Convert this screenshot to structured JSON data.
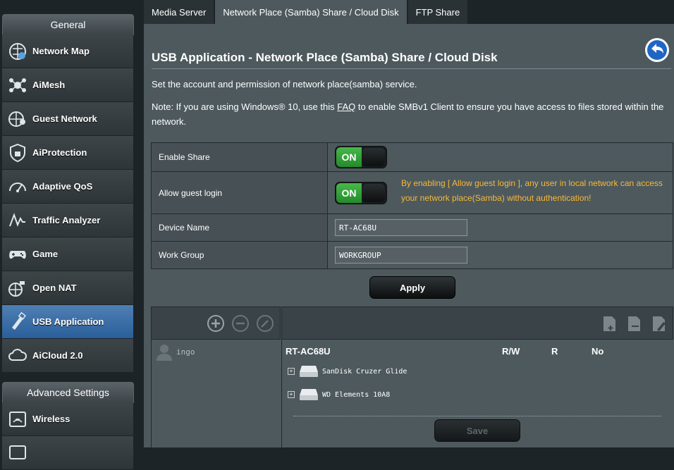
{
  "sidebar": {
    "general_header": "General",
    "general_items": [
      {
        "label": "Network Map",
        "icon": "network-map-icon"
      },
      {
        "label": "AiMesh",
        "icon": "aimesh-icon"
      },
      {
        "label": "Guest Network",
        "icon": "guest-network-icon"
      },
      {
        "label": "AiProtection",
        "icon": "aiprotection-icon"
      },
      {
        "label": "Adaptive QoS",
        "icon": "adaptive-qos-icon"
      },
      {
        "label": "Traffic Analyzer",
        "icon": "traffic-analyzer-icon"
      },
      {
        "label": "Game",
        "icon": "game-icon"
      },
      {
        "label": "Open NAT",
        "icon": "open-nat-icon"
      },
      {
        "label": "USB Application",
        "icon": "usb-application-icon",
        "active": true
      },
      {
        "label": "AiCloud 2.0",
        "icon": "aicloud-icon"
      }
    ],
    "advanced_header": "Advanced Settings",
    "advanced_items": [
      {
        "label": "Wireless",
        "icon": "wireless-icon"
      }
    ]
  },
  "tabs": [
    {
      "label": "Media Server",
      "active": false
    },
    {
      "label": "Network Place (Samba) Share / Cloud Disk",
      "active": true
    },
    {
      "label": "FTP Share",
      "active": false
    }
  ],
  "page": {
    "title": "USB Application - Network Place (Samba) Share / Cloud Disk",
    "description": "Set the account and permission of network place(samba) service.",
    "note_before": "Note: If you are using Windows® 10, use this ",
    "note_link": "FAQ",
    "note_after": " to enable SMBv1 Client to ensure you have access to files stored within the network."
  },
  "settings": {
    "enable_share_label": "Enable Share",
    "enable_share_state": "ON",
    "guest_login_label": "Allow guest login",
    "guest_login_state": "ON",
    "guest_warning": "By enabling [ Allow guest login ], any user in local network can access your network place(Samba) without authentication!",
    "device_name_label": "Device Name",
    "device_name_value": "RT-AC68U",
    "work_group_label": "Work Group",
    "work_group_value": "WORKGROUP",
    "apply_label": "Apply"
  },
  "share": {
    "account": "ingo",
    "device": "RT-AC68U",
    "perm_rw": "R/W",
    "perm_r": "R",
    "perm_no": "No",
    "disks": [
      "SanDisk Cruzer Glide",
      "WD Elements 10A8"
    ],
    "save_label": "Save"
  },
  "colors": {
    "accent_blue": "#2a5f9a",
    "on_green": "#3aa83d",
    "warning_orange": "#f8b83a"
  }
}
